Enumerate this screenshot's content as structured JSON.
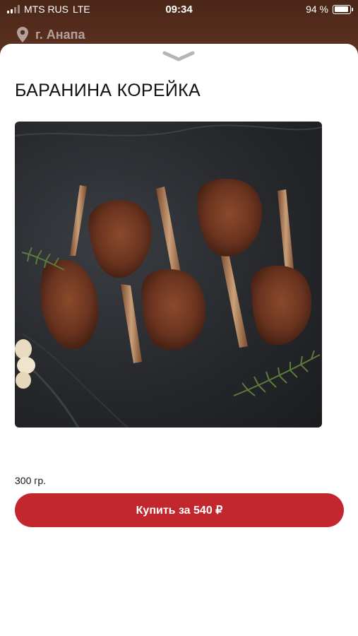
{
  "status_bar": {
    "carrier": "MTS RUS",
    "network": "LTE",
    "time": "09:34",
    "battery": "94 %"
  },
  "header": {
    "location": "г. Анапа"
  },
  "product": {
    "title": "БАРАНИНА КОРЕЙКА",
    "image_alt": "Lamb rack chops with rosemary and garlic",
    "weight": "300 гр.",
    "buy_label": "Купить за 540 ₽"
  },
  "colors": {
    "accent": "#c1272d",
    "header_bg": "#4e2a1a"
  }
}
